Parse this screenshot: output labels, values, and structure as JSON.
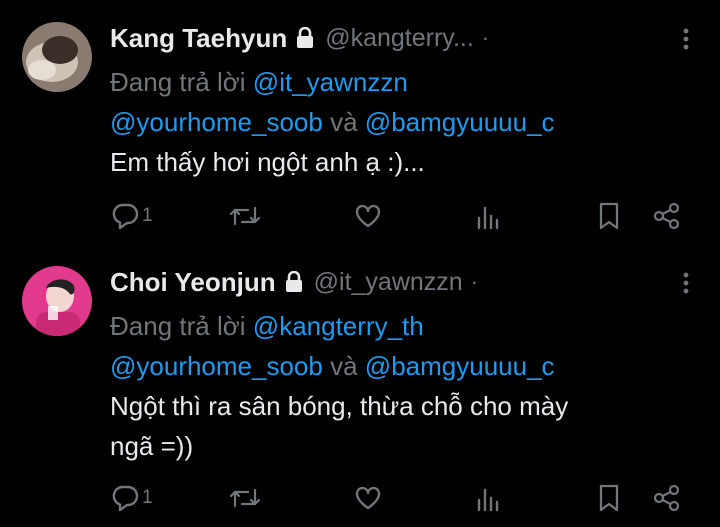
{
  "replies": [
    {
      "display_name": "Kang Taehyun",
      "handle": "@kangterry...",
      "separator": "·",
      "replying_to_label": "Đang trả lời",
      "replying_to_primary": "@it_yawnzzn",
      "replying_to_secondary": "@yourhome_soob",
      "replying_to_joiner": "và",
      "replying_to_tertiary": "@bamgyuuuu_c",
      "text": "Em thấy hơi ngột anh ạ :)...",
      "reply_count": "1",
      "colors": {
        "avatar_bg": "#8a7b70",
        "avatar_face": "#d8cdc2"
      }
    },
    {
      "display_name": "Choi Yeonjun",
      "handle": "@it_yawnzzn",
      "separator": "·",
      "replying_to_label": "Đang trả lời",
      "replying_to_primary": "@kangterry_th",
      "replying_to_secondary": "@yourhome_soob",
      "replying_to_joiner": "và",
      "replying_to_tertiary": "@bamgyuuuu_c",
      "text_line1": "Ngột thì ra sân bóng, thừa chỗ cho mày",
      "text_line2": "ngã =))",
      "reply_count": "1",
      "colors": {
        "avatar_bg": "#e23a8c",
        "avatar_face": "#f3d6cf"
      }
    }
  ],
  "icons": [
    "more-icon",
    "lock-icon",
    "reply-icon",
    "retweet-icon",
    "like-icon",
    "views-icon",
    "bookmark-icon",
    "share-icon"
  ],
  "theme": {
    "background": "#000000",
    "text": "#e7e9ea",
    "muted": "#71767b",
    "link": "#1d9bf0"
  }
}
